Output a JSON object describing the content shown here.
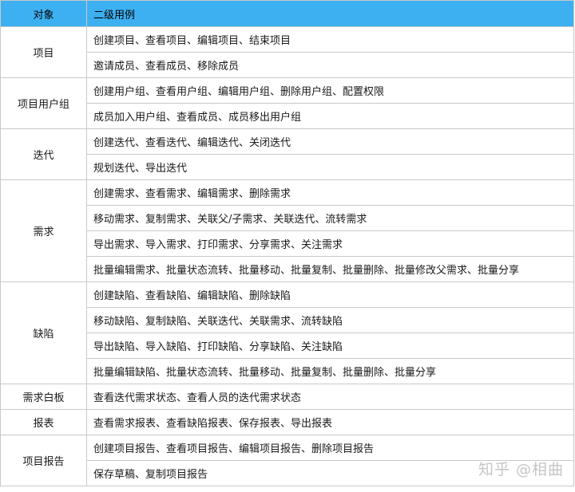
{
  "header": {
    "object": "对象",
    "use_case": "二级用例"
  },
  "groups": [
    {
      "object": "项目",
      "items": [
        "创建项目、查看项目、编辑项目、结束项目",
        "邀请成员、查看成员、移除成员"
      ]
    },
    {
      "object": "项目用户组",
      "items": [
        "创建用户组、查看用户组、编辑用户组、删除用户组、配置权限",
        "成员加入用户组、查看成员、成员移出用户组"
      ]
    },
    {
      "object": "迭代",
      "items": [
        "创建迭代、查看迭代、编辑迭代、关闭迭代",
        "规划迭代、导出迭代"
      ]
    },
    {
      "object": "需求",
      "items": [
        "创建需求、查看需求、编辑需求、删除需求",
        "移动需求、复制需求、关联父/子需求、关联迭代、流转需求",
        "导出需求、导入需求、打印需求、分享需求、关注需求",
        "批量编辑需求、批量状态流转、批量移动、批量复制、批量删除、批量修改父需求、批量分享"
      ]
    },
    {
      "object": "缺陷",
      "items": [
        "创建缺陷、查看缺陷、编辑缺陷、删除缺陷",
        "移动缺陷、复制缺陷、关联迭代、关联需求、流转缺陷",
        "导出缺陷、导入缺陷、打印缺陷、分享缺陷、关注缺陷",
        "批量编辑缺陷、批量状态流转、批量移动、批量复制、批量删除、批量分享"
      ]
    },
    {
      "object": "需求白板",
      "items": [
        "查看迭代需求状态、查看人员的迭代需求状态"
      ]
    },
    {
      "object": "报表",
      "items": [
        "查看需求报表、查看缺陷报表、保存报表、导出报表"
      ]
    },
    {
      "object": "项目报告",
      "items": [
        "创建项目报告、查看项目报告、编辑项目报告、删除项目报告",
        "保存草稿、复制项目报告"
      ]
    }
  ],
  "watermark": "知乎 @相曲",
  "colors": {
    "header_bg": "#3db0f2",
    "border": "#c9c9c9"
  }
}
